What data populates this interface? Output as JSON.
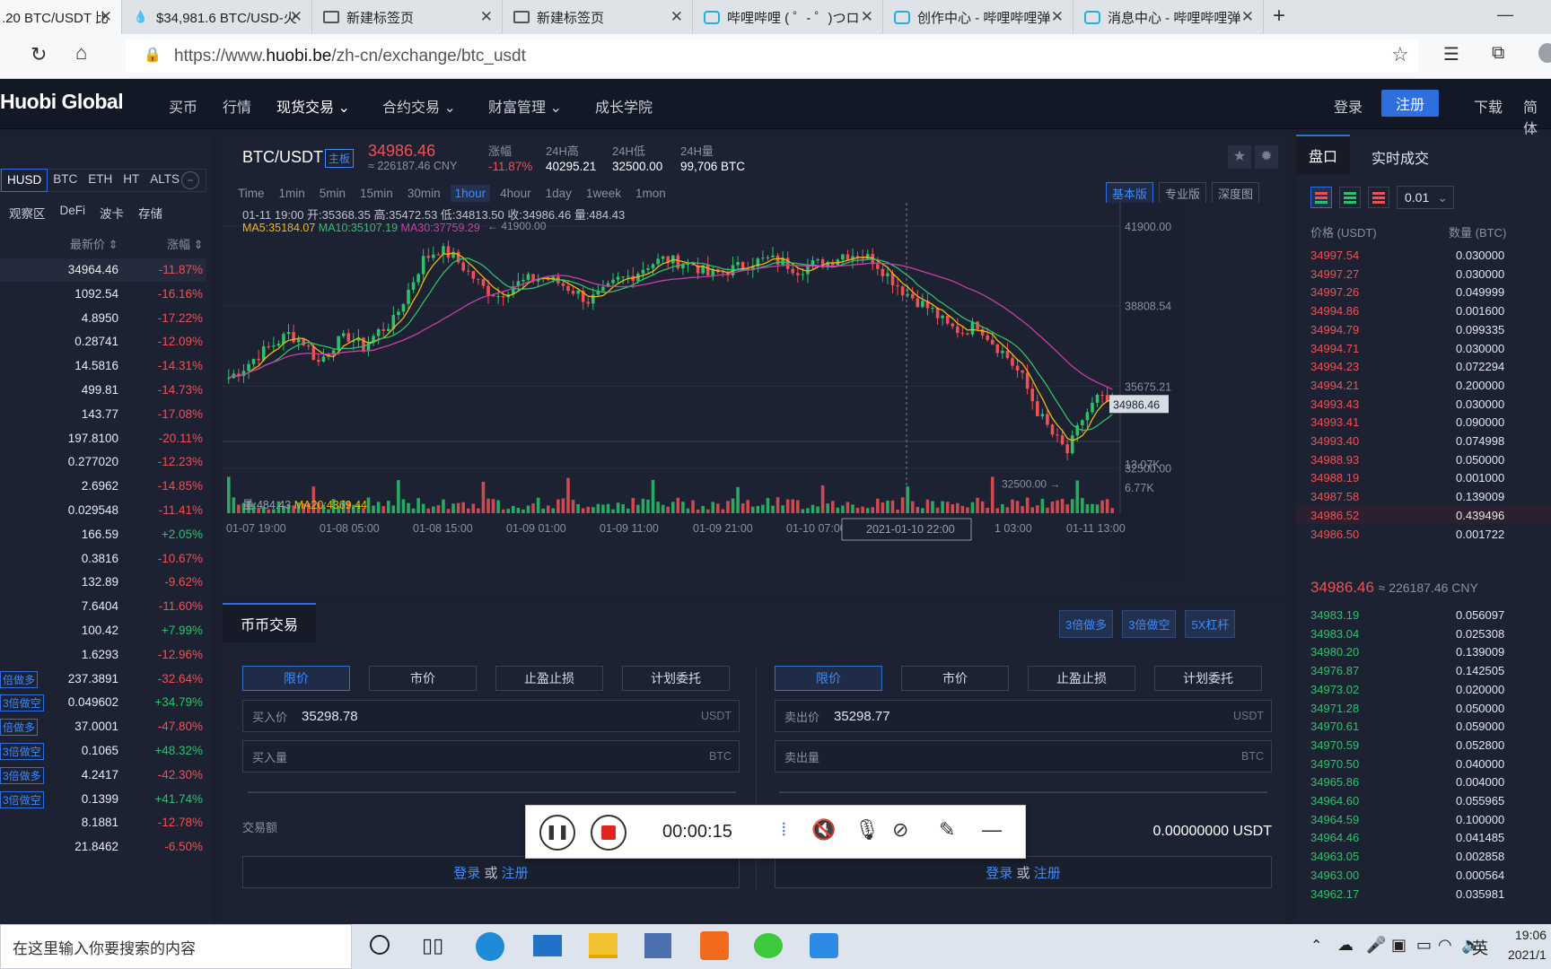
{
  "browser": {
    "tabs": [
      {
        "title": ".20 BTC/USDT 比"
      },
      {
        "title": "$34,981.6 BTC/USD-火"
      },
      {
        "title": "新建标签页"
      },
      {
        "title": "新建标签页"
      },
      {
        "title": "哔哩哔哩 ( ゜- ゜)つロ 干"
      },
      {
        "title": "创作中心 - 哔哩哔哩弹"
      },
      {
        "title": "消息中心 - 哔哩哔哩弹"
      }
    ],
    "url_prefix": "https://www.",
    "url_domain": "huobi.be",
    "url_path": "/zh-cn/exchange/btc_usdt"
  },
  "nav": {
    "logo": "Huobi Global",
    "items": [
      "买币",
      "行情",
      "现货交易",
      "合约交易",
      "财富管理",
      "成长学院"
    ],
    "login": "登录",
    "register": "注册",
    "download": "下载",
    "lang": "简体"
  },
  "market_list": {
    "quote_tabs": [
      "HUSD",
      "BTC",
      "ETH",
      "HT",
      "ALTS"
    ],
    "sub_tabs": [
      "观察区",
      "DeFi",
      "波卡",
      "存储"
    ],
    "col_price": "最新价",
    "col_change": "涨幅",
    "rows": [
      {
        "tag": "",
        "price": "34964.46",
        "change": "-11.87%"
      },
      {
        "tag": "",
        "price": "1092.54",
        "change": "-16.16%"
      },
      {
        "tag": "",
        "price": "4.8950",
        "change": "-17.22%"
      },
      {
        "tag": "",
        "price": "0.28741",
        "change": "-12.09%"
      },
      {
        "tag": "",
        "price": "14.5816",
        "change": "-14.31%"
      },
      {
        "tag": "",
        "price": "499.81",
        "change": "-14.73%"
      },
      {
        "tag": "",
        "price": "143.77",
        "change": "-17.08%"
      },
      {
        "tag": "",
        "price": "197.8100",
        "change": "-20.11%"
      },
      {
        "tag": "",
        "price": "0.277020",
        "change": "-12.23%"
      },
      {
        "tag": "",
        "price": "2.6962",
        "change": "-14.85%"
      },
      {
        "tag": "",
        "price": "0.029548",
        "change": "-11.41%"
      },
      {
        "tag": "",
        "price": "166.59",
        "change": "+2.05%"
      },
      {
        "tag": "",
        "price": "0.3816",
        "change": "-10.67%"
      },
      {
        "tag": "",
        "price": "132.89",
        "change": "-9.62%"
      },
      {
        "tag": "",
        "price": "7.6404",
        "change": "-11.60%"
      },
      {
        "tag": "",
        "price": "100.42",
        "change": "+7.99%"
      },
      {
        "tag": "",
        "price": "1.6293",
        "change": "-12.96%"
      },
      {
        "tag": "倍做多",
        "price": "237.3891",
        "change": "-32.64%"
      },
      {
        "tag": "3倍做空",
        "price": "0.049602",
        "change": "+34.79%"
      },
      {
        "tag": "倍做多",
        "price": "37.0001",
        "change": "-47.80%"
      },
      {
        "tag": "3倍做空",
        "price": "0.1065",
        "change": "+48.32%"
      },
      {
        "tag": "3倍做多",
        "price": "4.2417",
        "change": "-42.30%"
      },
      {
        "tag": "3倍做空",
        "price": "0.1399",
        "change": "+41.74%"
      },
      {
        "tag": "",
        "price": "8.1881",
        "change": "-12.78%"
      },
      {
        "tag": "",
        "price": "21.8462",
        "change": "-6.50%"
      }
    ]
  },
  "ticker": {
    "pair": "BTC/USDT",
    "board": "主板",
    "price": "34986.46",
    "cny": "≈ 226187.46 CNY",
    "change_label": "涨幅",
    "change": "-11.87%",
    "high_label": "24H高",
    "high": "40295.21",
    "low_label": "24H低",
    "low": "32500.00",
    "vol_label": "24H量",
    "vol": "99,706 BTC"
  },
  "chart_toolbar": {
    "intervals": [
      "Time",
      "1min",
      "5min",
      "15min",
      "30min",
      "1hour",
      "4hour",
      "1day",
      "1week",
      "1mon"
    ],
    "active": "1hour",
    "views": [
      "基本版",
      "专业版",
      "深度图"
    ]
  },
  "chart_info": {
    "ohlc": "01-11 19:00  开:35368.35  高:35472.53  低:34813.50  收:34986.46  量:484.43",
    "ma5": "MA5:35184.07",
    "ma10": "MA10:35107.19",
    "ma30": "MA30:37759.29",
    "vol_line": "量:484.43",
    "vol_ma": "MA20:4369.44",
    "high_marker": "41900.00",
    "low_marker": "32500.00",
    "last_price_tag": "34986.46",
    "crosshair_time": "2021-01-10 22:00"
  },
  "chart_data": {
    "type": "candlestick",
    "y_ticks": [
      "41900.00",
      "38808.54",
      "35675.21",
      "32500.00"
    ],
    "vol_ticks": [
      "13.07K",
      "6.77K"
    ],
    "x_ticks": [
      "01-07 19:00",
      "01-08 05:00",
      "01-08 15:00",
      "01-09 01:00",
      "01-09 11:00",
      "01-09 21:00",
      "01-10 07:00",
      "1 03:00",
      "01-11 13:00"
    ],
    "ylim": [
      32000,
      42800
    ],
    "close_path": [
      36000,
      36400,
      36900,
      37300,
      37700,
      37400,
      36600,
      37300,
      37600,
      37200,
      37800,
      38200,
      39400,
      40600,
      41000,
      40700,
      40100,
      39500,
      39200,
      39600,
      39800,
      39900,
      39700,
      39400,
      39000,
      39300,
      39800,
      40000,
      40400,
      40600,
      40500,
      40400,
      40000,
      40100,
      40300,
      40500,
      40600,
      40500,
      40200,
      40400,
      40500,
      40800,
      40800,
      40600,
      40000,
      39400,
      39000,
      38600,
      38000,
      37800,
      38100,
      37400,
      36800,
      36000,
      34700,
      33800,
      33100,
      34400,
      35200,
      34986
    ]
  },
  "trade": {
    "title": "币币交易",
    "leverage_tags": [
      "3倍做多",
      "3倍做空",
      "5X杠杆"
    ],
    "order_types": [
      "限价",
      "市价",
      "止盈止损",
      "计划委托"
    ],
    "buy_price_label": "买入价",
    "buy_price": "35298.78",
    "buy_amount_label": "买入量",
    "sell_price_label": "卖出价",
    "sell_price": "35298.77",
    "sell_amount_label": "卖出量",
    "unit_usdt": "USDT",
    "unit_btc": "BTC",
    "turnover_label": "交易额",
    "sell_turnover": "0.00000000 USDT",
    "login": "登录",
    "or": "或",
    "register": "注册"
  },
  "recorder": {
    "time": "00:00:15"
  },
  "orderbook": {
    "tabs": [
      "盘口",
      "实时成交"
    ],
    "precision": "0.01",
    "col_price": "价格 (USDT)",
    "col_amount": "数量 (BTC)",
    "asks": [
      [
        "34997.54",
        "0.030000"
      ],
      [
        "34997.27",
        "0.030000"
      ],
      [
        "34997.26",
        "0.049999"
      ],
      [
        "34994.86",
        "0.001600"
      ],
      [
        "34994.79",
        "0.099335"
      ],
      [
        "34994.71",
        "0.030000"
      ],
      [
        "34994.23",
        "0.072294"
      ],
      [
        "34994.21",
        "0.200000"
      ],
      [
        "34993.43",
        "0.030000"
      ],
      [
        "34993.41",
        "0.090000"
      ],
      [
        "34993.40",
        "0.074998"
      ],
      [
        "34988.93",
        "0.050000"
      ],
      [
        "34988.19",
        "0.001000"
      ],
      [
        "34987.58",
        "0.139009"
      ],
      [
        "34986.52",
        "0.439496"
      ],
      [
        "34986.50",
        "0.001722"
      ]
    ],
    "last_price": "34986.46",
    "last_cny": "≈ 226187.46 CNY",
    "bids": [
      [
        "34983.19",
        "0.056097"
      ],
      [
        "34983.04",
        "0.025308"
      ],
      [
        "34980.20",
        "0.139009"
      ],
      [
        "34976.87",
        "0.142505"
      ],
      [
        "34973.02",
        "0.020000"
      ],
      [
        "34971.28",
        "0.050000"
      ],
      [
        "34970.61",
        "0.059000"
      ],
      [
        "34970.59",
        "0.052800"
      ],
      [
        "34970.50",
        "0.040000"
      ],
      [
        "34965.86",
        "0.004000"
      ],
      [
        "34964.60",
        "0.055965"
      ],
      [
        "34964.59",
        "0.100000"
      ],
      [
        "34964.46",
        "0.041485"
      ],
      [
        "34963.05",
        "0.002858"
      ],
      [
        "34963.00",
        "0.000564"
      ],
      [
        "34962.17",
        "0.035981"
      ]
    ]
  },
  "taskbar": {
    "search_placeholder": "在这里输入你要搜索的内容",
    "ime": "英",
    "time": "19:06",
    "date": "2021/1"
  }
}
